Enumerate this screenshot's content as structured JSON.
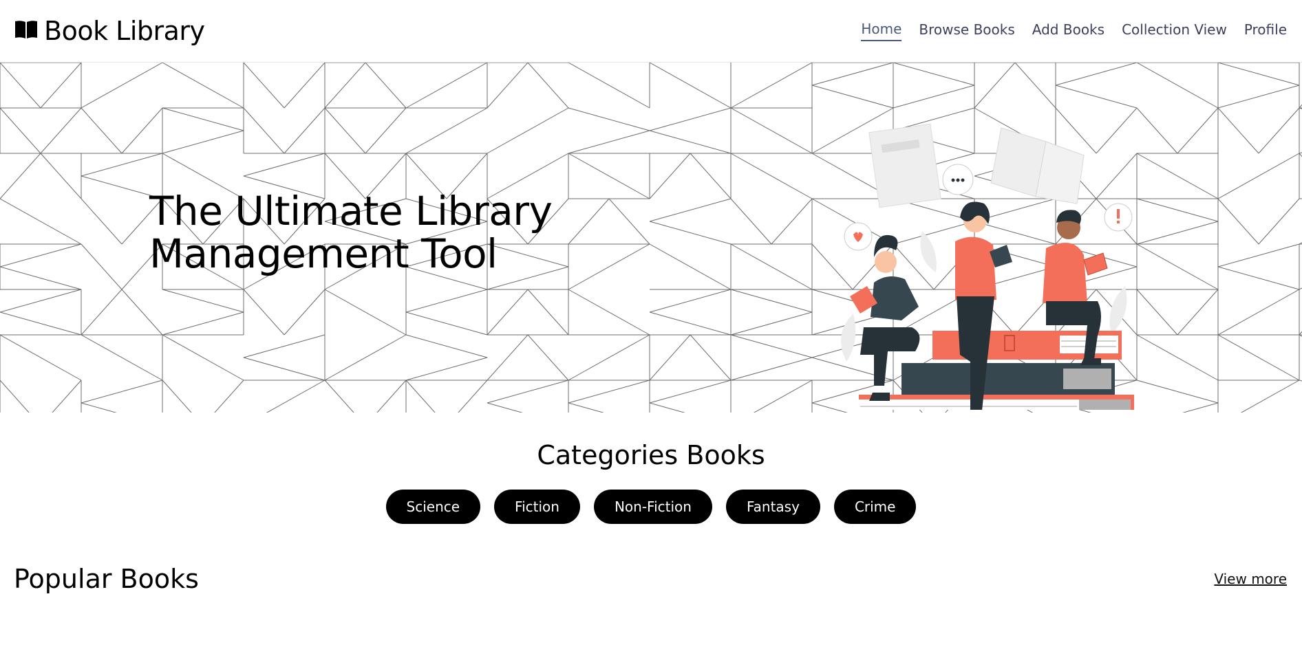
{
  "nav": {
    "brand_icon": "open-book-icon",
    "brand_title": "Book Library",
    "links": [
      "Home",
      "Browse Books",
      "Add Books",
      "Collection View",
      "Profile"
    ],
    "active": "Home",
    "active_color": "#47577e"
  },
  "hero": {
    "title": "The Ultimate Library Management Tool",
    "illustration": "people-reading-on-books-illustration",
    "accent_color": "#f36f5a",
    "dark_color": "#263238"
  },
  "categories": {
    "title": "Categories Books",
    "items": [
      "Science",
      "Fiction",
      "Non-Fiction",
      "Fantasy",
      "Crime"
    ]
  },
  "popular": {
    "title": "Popular Books",
    "view_more": "View more"
  }
}
